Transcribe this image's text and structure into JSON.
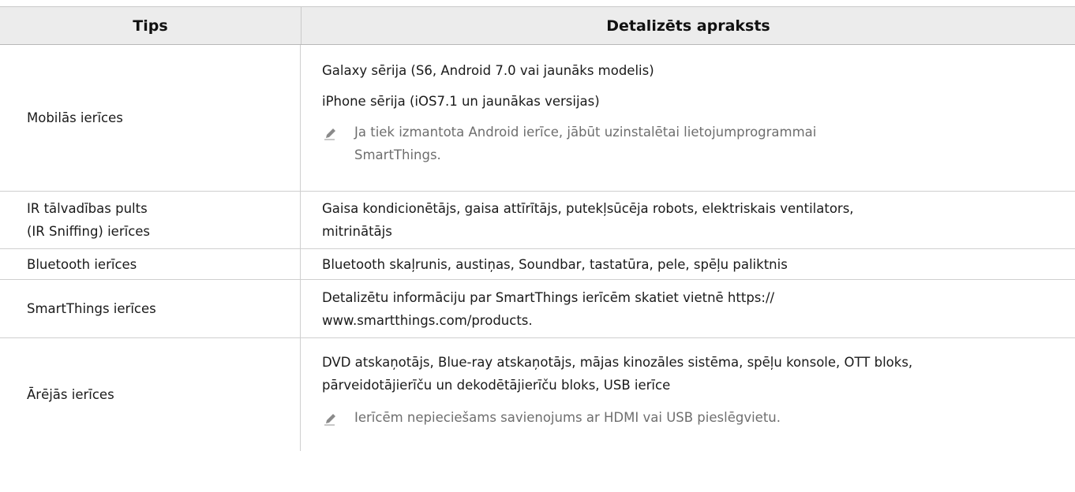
{
  "table": {
    "headers": [
      "Tips",
      "Detalizēts apraksts"
    ],
    "rows": [
      {
        "type": "Mobilās ierīces",
        "desc": [
          "Galaxy sērija (S6, Android 7.0 vai jaunāks modelis)",
          "iPhone sērija (iOS7.1 un jaunākas versijas)"
        ],
        "note": [
          "Ja tiek izmantota Android ierīce, jābūt uzinstalētai lietojumprogrammai",
          "SmartThings."
        ]
      },
      {
        "type": [
          "IR tālvadības pults",
          "(IR Sniffing) ierīces"
        ],
        "desc": [
          "Gaisa kondicionētājs, gaisa attīrītājs, putekļsūcēja robots, elektriskais ventilators,",
          "mitrinātājs"
        ]
      },
      {
        "type": "Bluetooth ierīces",
        "desc": [
          "Bluetooth skaļrunis, austiņas, Soundbar, tastatūra, pele, spēļu paliktnis"
        ]
      },
      {
        "type": "SmartThings ierīces",
        "desc": [
          "Detalizētu informāciju par SmartThings ierīcēm skatiet vietnē https://",
          "www.smartthings.com/products."
        ]
      },
      {
        "type": "Ārējās ierīces",
        "desc": [
          "DVD atskaņotājs, Blue-ray atskaņotājs, mājas kinozāles sistēma, spēļu konsole, OTT bloks,",
          "pārveidotājierīču un dekodētājierīču bloks, USB ierīce"
        ],
        "note": [
          "Ierīcēm nepieciešams savienojums ar HDMI vai USB pieslēgvietu."
        ]
      }
    ]
  },
  "icons": {
    "note": "pencil-note-icon"
  },
  "colors": {
    "header_bg": "#ececec",
    "note_text": "#6e6e6e",
    "border": "#cfcfcf"
  }
}
